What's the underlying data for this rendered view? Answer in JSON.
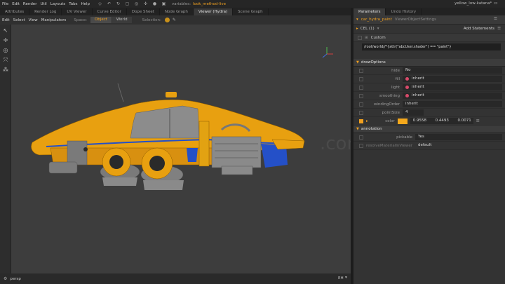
{
  "menubar": {
    "items": [
      "File",
      "Edit",
      "Render",
      "Util",
      "Layouts",
      "Tabs",
      "Help"
    ],
    "variables_label": "variables:",
    "variables_value": "look_method",
    "variables_live": "-live",
    "user": "yellow_low-katana*"
  },
  "left_tabs": [
    "Attributes",
    "Render Log",
    "UV Viewer",
    "Curve Editor",
    "Dope Sheet",
    "Node Graph",
    "Viewer (Hydra)",
    "Scene Graph"
  ],
  "right_tabs": [
    "Parameters",
    "Undo History"
  ],
  "viewport_toolbar": {
    "menus": [
      "Edit",
      "Select",
      "View",
      "Manipulators"
    ],
    "space_label": "Space:",
    "space_options": [
      "Object",
      "World"
    ],
    "selection_label": "Selection:"
  },
  "viewport": {
    "camera": "persp",
    "status_right": "EH",
    "watermark": ".com"
  },
  "params": {
    "node_name": "car_hydra_paint",
    "node_type": "ViewerObjectSettings",
    "cel_label": "CEL (1)",
    "add_statements": "Add Statements",
    "custom_label": "Custom",
    "cel_expression": "/root/world//*{attr(\"abcUser.shader\") == \"paint\"}",
    "sections": {
      "draw_options": "drawOptions",
      "annotation": "annotation"
    },
    "draw_options": [
      {
        "label": "hide",
        "value": "No",
        "dot": false
      },
      {
        "label": "fill",
        "value": "inherit",
        "dot": true
      },
      {
        "label": "light",
        "value": "inherit",
        "dot": true
      },
      {
        "label": "smoothing",
        "value": "inherit",
        "dot": true
      },
      {
        "label": "windingOrder",
        "value": "inherit",
        "dot": false
      },
      {
        "label": "pointSize",
        "value": "4",
        "dot": false
      }
    ],
    "color": {
      "label": "color",
      "r": "0.9558",
      "g": "0.4493",
      "b": "0.0071",
      "swatch": "#f5a81c"
    },
    "annotation_rows": [
      {
        "label": "pickable",
        "value": "Yes"
      },
      {
        "label": "resolveMaterialInViewer",
        "value": "default"
      }
    ]
  },
  "colors": {
    "accent": "#f0a020",
    "car_body": "#e8a010",
    "car_trim": "#2450c8",
    "viewport_bg": "#3d3d3d"
  }
}
